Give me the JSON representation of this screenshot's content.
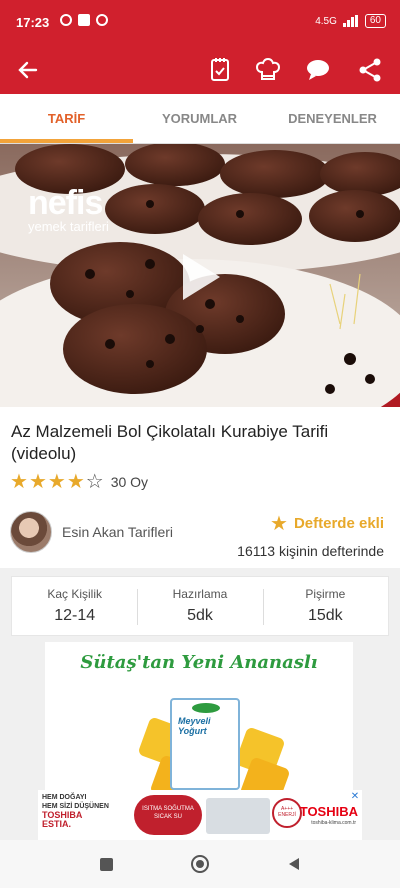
{
  "status_bar": {
    "time": "17:23",
    "battery": "60",
    "network": "4.5G"
  },
  "toolbar": {
    "back_icon": "arrow-left-icon",
    "icons": [
      "notebook-check-icon",
      "chef-hat-icon",
      "chat-bubble-icon",
      "share-icon"
    ]
  },
  "tabs": [
    {
      "label": "TARİF",
      "active": true
    },
    {
      "label": "YORUMLAR",
      "active": false
    },
    {
      "label": "DENEYENLER",
      "active": false
    }
  ],
  "hero": {
    "logo_main": "nefis",
    "logo_sub": "yemek tarifleri",
    "play_icon": "play-icon"
  },
  "recipe": {
    "title": "Az Malzemeli Bol Çikolatalı Kurabiye Tarifi (videolu)",
    "rating": 4,
    "rating_max": 5,
    "votes": "30 Oy"
  },
  "author": {
    "name": "Esin Akan Tarifleri"
  },
  "favorite": {
    "label": "Defterde ekli",
    "count": "16113 kişinin defterinde"
  },
  "stats": [
    {
      "label": "Kaç Kişilik",
      "value": "12-14"
    },
    {
      "label": "Hazırlama",
      "value": "5dk"
    },
    {
      "label": "Pişirme",
      "value": "15dk"
    }
  ],
  "ad": {
    "headline": "Sütaş'tan Yeni Ananaslı",
    "pack_brand": "sütaş",
    "pack_name": "Meyveli Yoğurt"
  },
  "banner": {
    "line1": "HEM DOĞAYI",
    "line2": "HEM SİZİ DÜŞÜNEN",
    "line3": "TOSHIBA",
    "line4": "ESTIA.",
    "pill": "ISITMA SOĞUTMA SICAK SU",
    "badge": "A+++ ENERJİ",
    "brand": "TOSHIBA",
    "site": "toshiba-klima.com.tr"
  },
  "colors": {
    "brand_red": "#d0202d",
    "accent_orange": "#e2612a",
    "star_gold": "#e8a92b"
  }
}
